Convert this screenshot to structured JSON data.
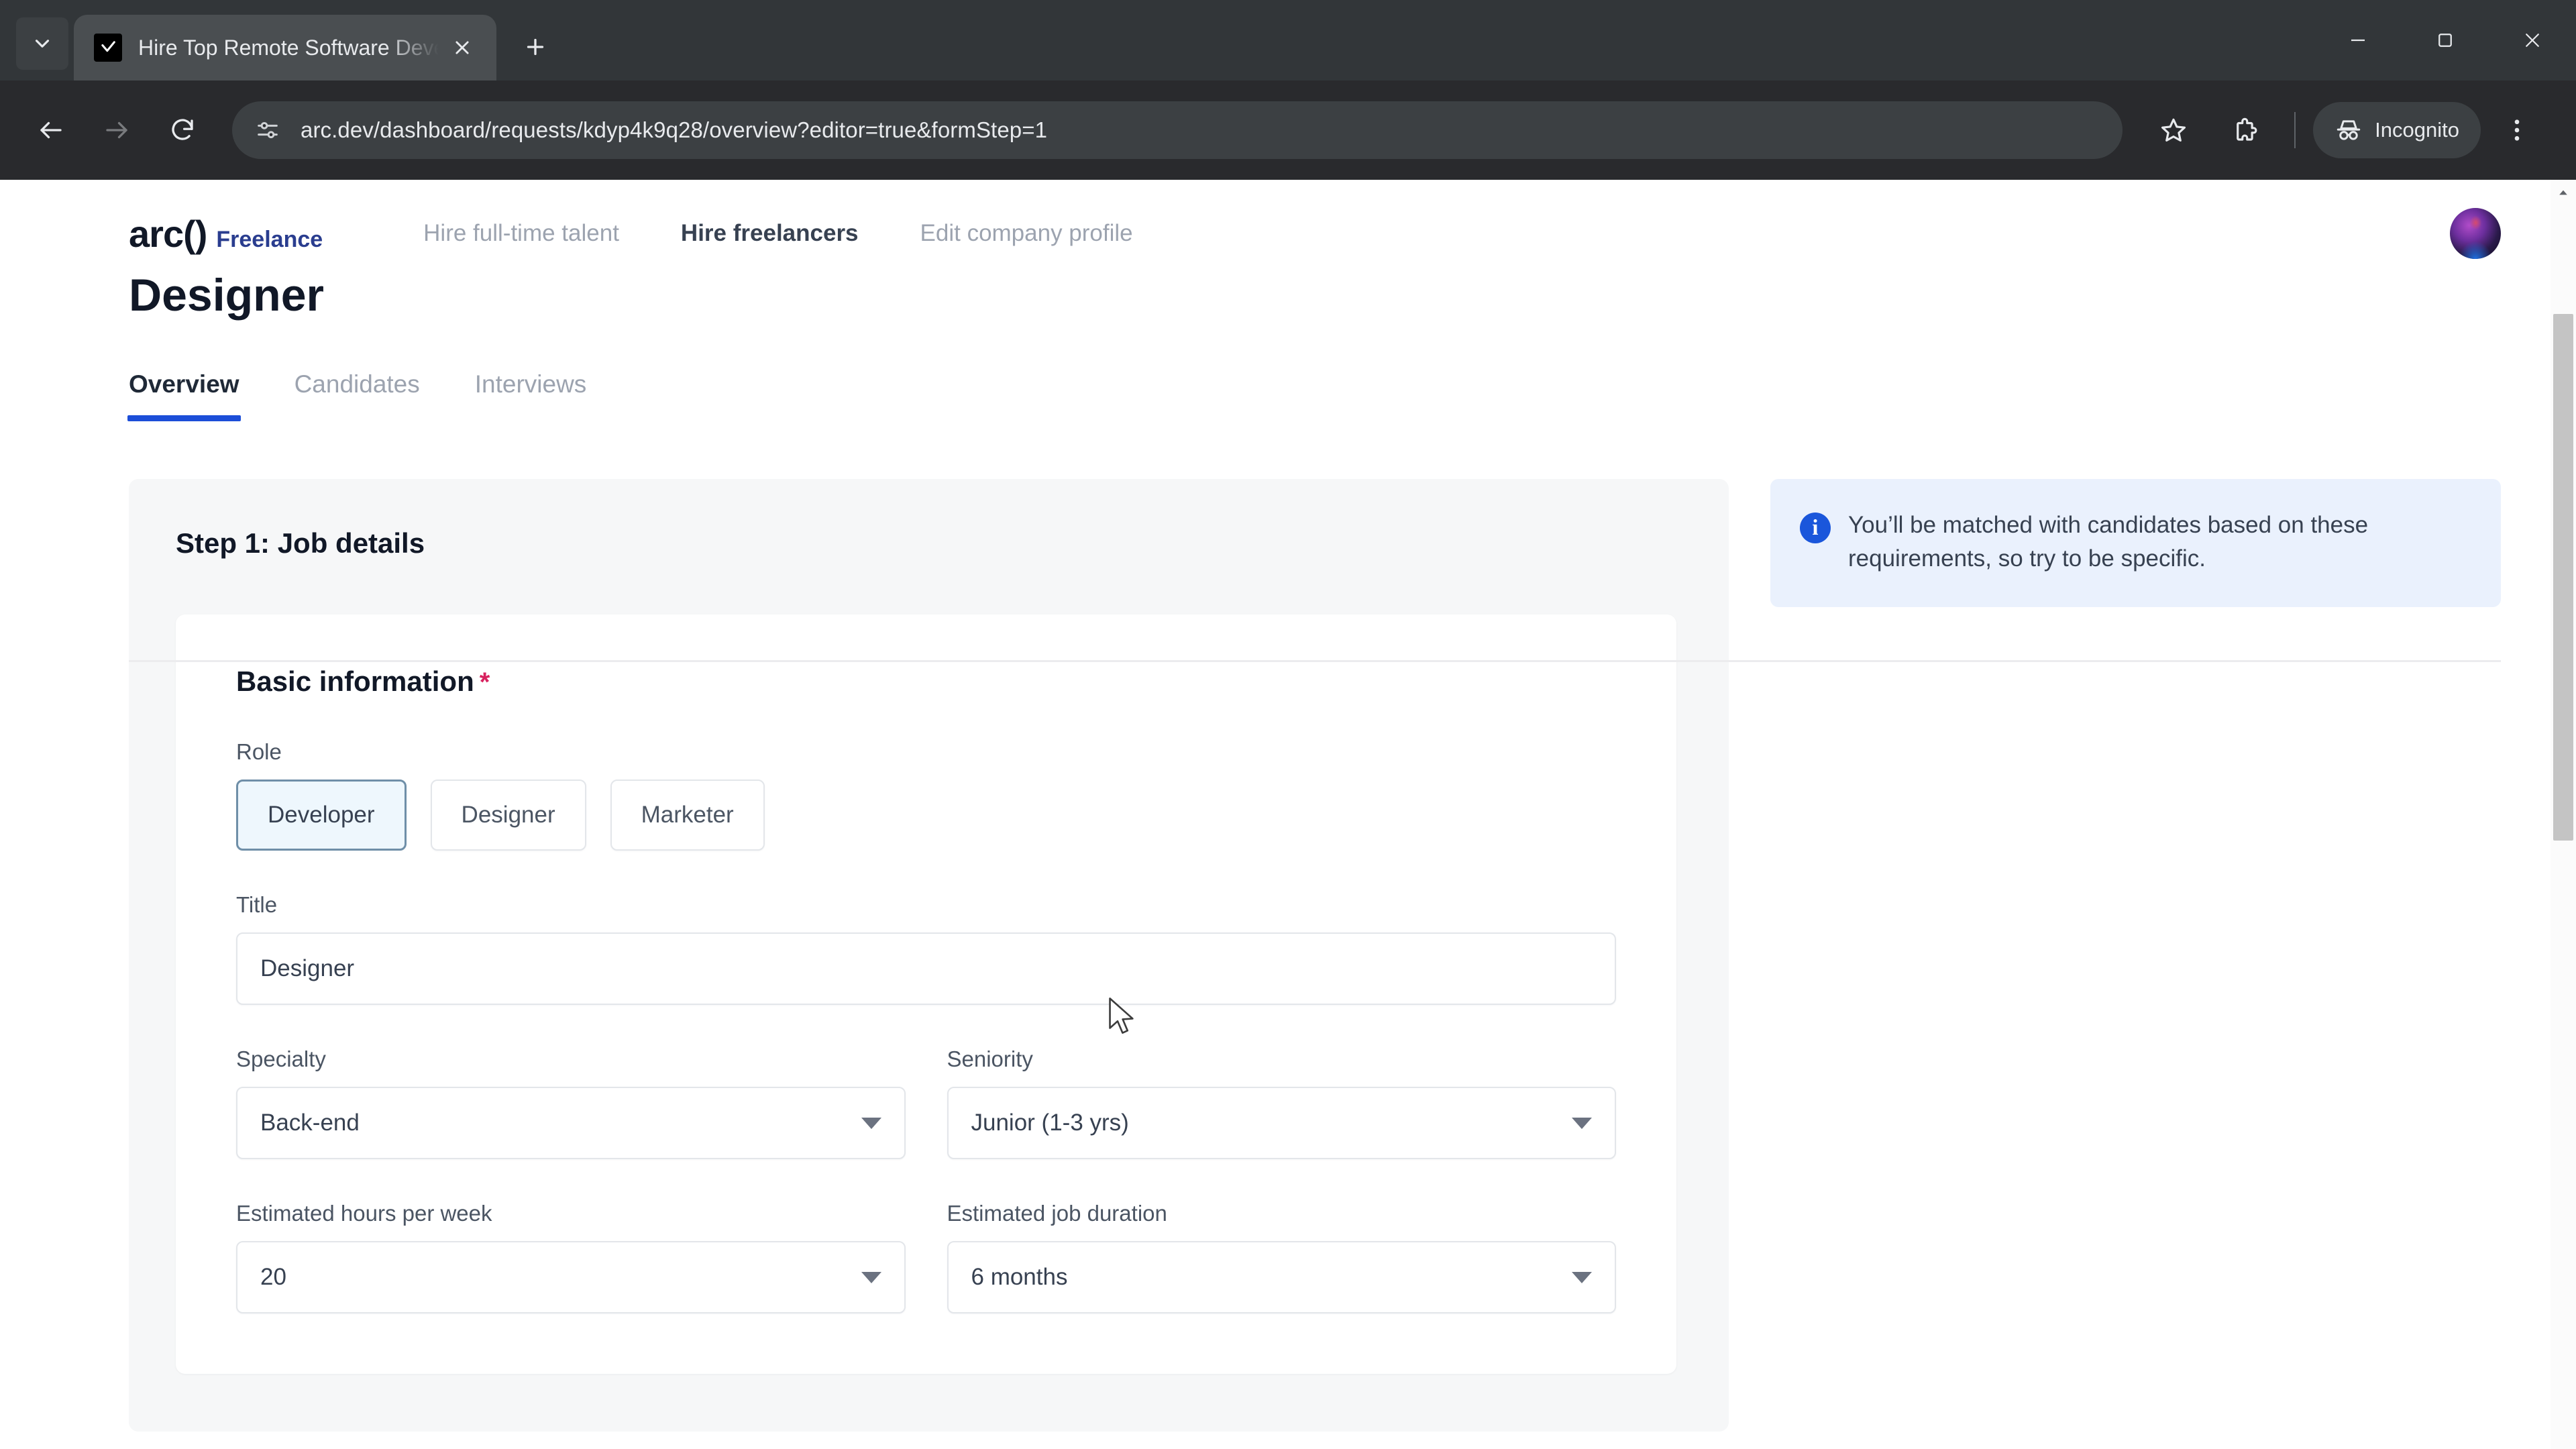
{
  "browser": {
    "tab": {
      "title": "Hire Top Remote Software Deve",
      "favicon_name": "arc-check-favicon",
      "close_label": "×"
    },
    "new_tab_label": "+",
    "tab_search_label": "Search tabs",
    "window": {
      "minimize_label": "Minimize",
      "maximize_label": "Maximize",
      "close_label": "Close"
    },
    "toolbar": {
      "back_label": "Back",
      "forward_label": "Forward",
      "reload_label": "Reload",
      "url": "arc.dev/dashboard/requests/kdyp4k9q28/overview?editor=true&formStep=1",
      "site_info_label": "View site information",
      "bookmark_label": "Bookmark this tab",
      "extensions_label": "Extensions",
      "incognito_label": "Incognito",
      "menu_label": "Customize and control Google Chrome"
    }
  },
  "site": {
    "brand": {
      "mark": "arc()",
      "suffix": "Freelance"
    },
    "nav": [
      {
        "label": "Hire full-time talent",
        "active": false
      },
      {
        "label": "Hire freelancers",
        "active": true
      },
      {
        "label": "Edit company profile",
        "active": false
      }
    ],
    "avatar_label": "Account"
  },
  "page": {
    "title": "Designer",
    "tabs": [
      {
        "label": "Overview",
        "active": true
      },
      {
        "label": "Candidates",
        "active": false
      },
      {
        "label": "Interviews",
        "active": false
      }
    ]
  },
  "form": {
    "step_title": "Step 1: Job details",
    "section_title": "Basic information",
    "required_marker": "*",
    "role": {
      "label": "Role",
      "options": [
        {
          "label": "Developer",
          "selected": true
        },
        {
          "label": "Designer",
          "selected": false
        },
        {
          "label": "Marketer",
          "selected": false
        }
      ]
    },
    "title_field": {
      "label": "Title",
      "value": "Designer",
      "placeholder": "Title"
    },
    "specialty": {
      "label": "Specialty",
      "value": "Back-end"
    },
    "seniority": {
      "label": "Seniority",
      "value": "Junior (1-3 yrs)"
    },
    "hours_per_week": {
      "label": "Estimated hours per week",
      "value": "20"
    },
    "job_duration": {
      "label": "Estimated job duration",
      "value": "6 months"
    }
  },
  "callout": {
    "icon_name": "info-icon",
    "icon_glyph": "i",
    "text": "You’ll be matched with candidates based on these requirements, so try to be specific."
  },
  "colors": {
    "accent_blue": "#1c4ed8",
    "callout_bg": "#eaf1fd",
    "required_red": "#d7215e",
    "brand_navy": "#2a3d8f",
    "chrome_dark": "#292a2d"
  }
}
